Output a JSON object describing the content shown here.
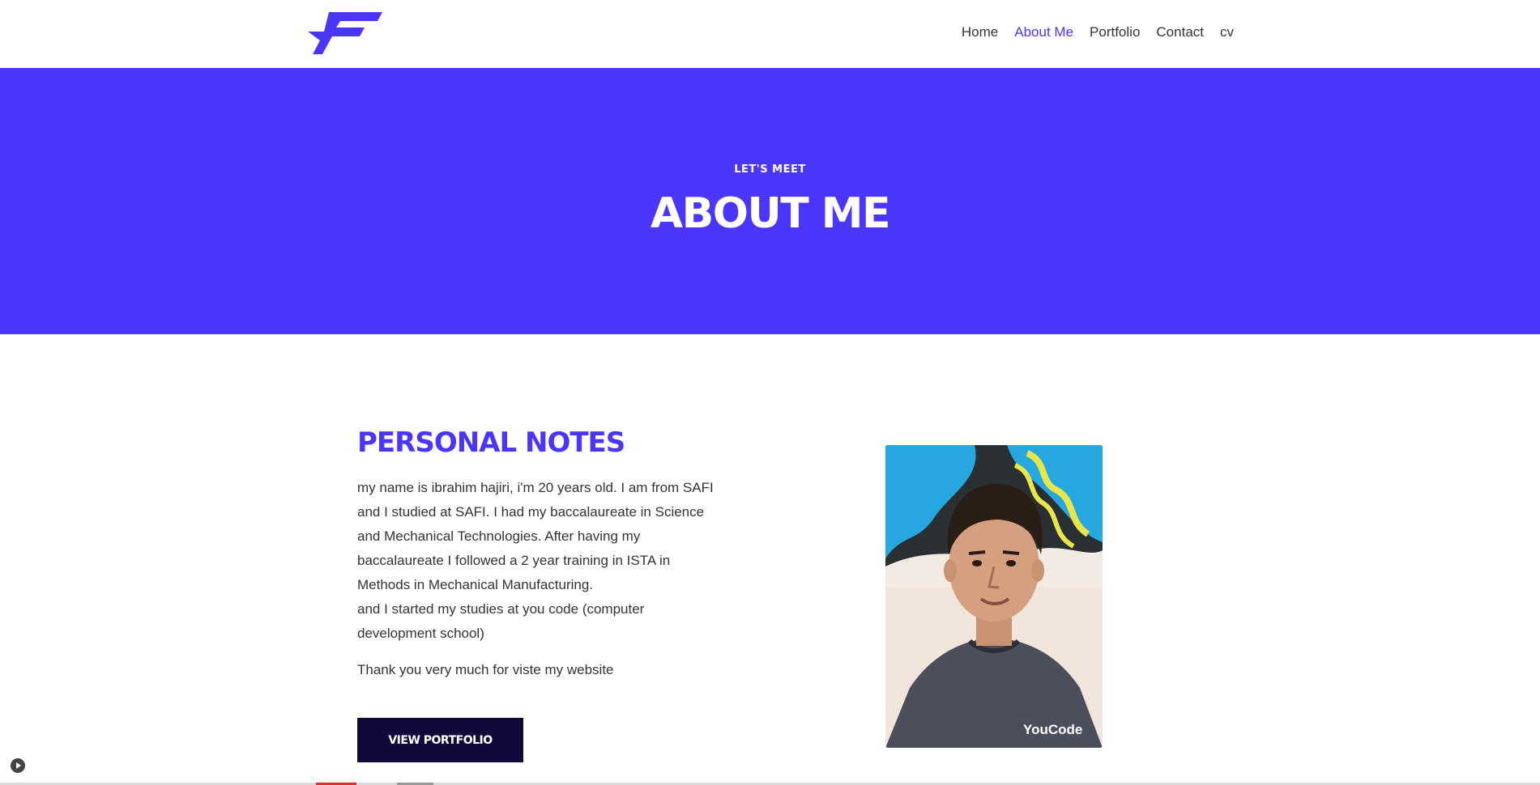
{
  "header": {
    "logo_icon": "stylized-f-logo-icon",
    "brand_color": "#4b36f8",
    "nav": [
      {
        "label": "Home",
        "active": false
      },
      {
        "label": "About Me",
        "active": true
      },
      {
        "label": "Portfolio",
        "active": false
      },
      {
        "label": "Contact",
        "active": false
      },
      {
        "label": "cv",
        "active": false
      }
    ]
  },
  "hero": {
    "kicker": "LET'S MEET",
    "title": "ABOUT ME",
    "background": "#4b36fd"
  },
  "notes": {
    "title": "PERSONAL NOTES",
    "paragraph_lines": [
      "my name is ibrahim hajiri, i'm 20 years old. I am from SAFI",
      "and I studied at SAFI. I had my baccalaureate in Science",
      "and Mechanical Technologies. After having my",
      "baccalaureate I followed a 2 year training in ISTA in",
      "Methods in Mechanical Manufacturing.",
      "and I started my studies at you code (computer",
      "development school)"
    ],
    "thanks": "Thank you very much for viste my website",
    "button_label": "VIEW PORTFOLIO",
    "button_color": "#0f0a3a"
  },
  "photo": {
    "shirt_text": "YouCode"
  },
  "misc": {
    "play_icon": "play-icon"
  }
}
